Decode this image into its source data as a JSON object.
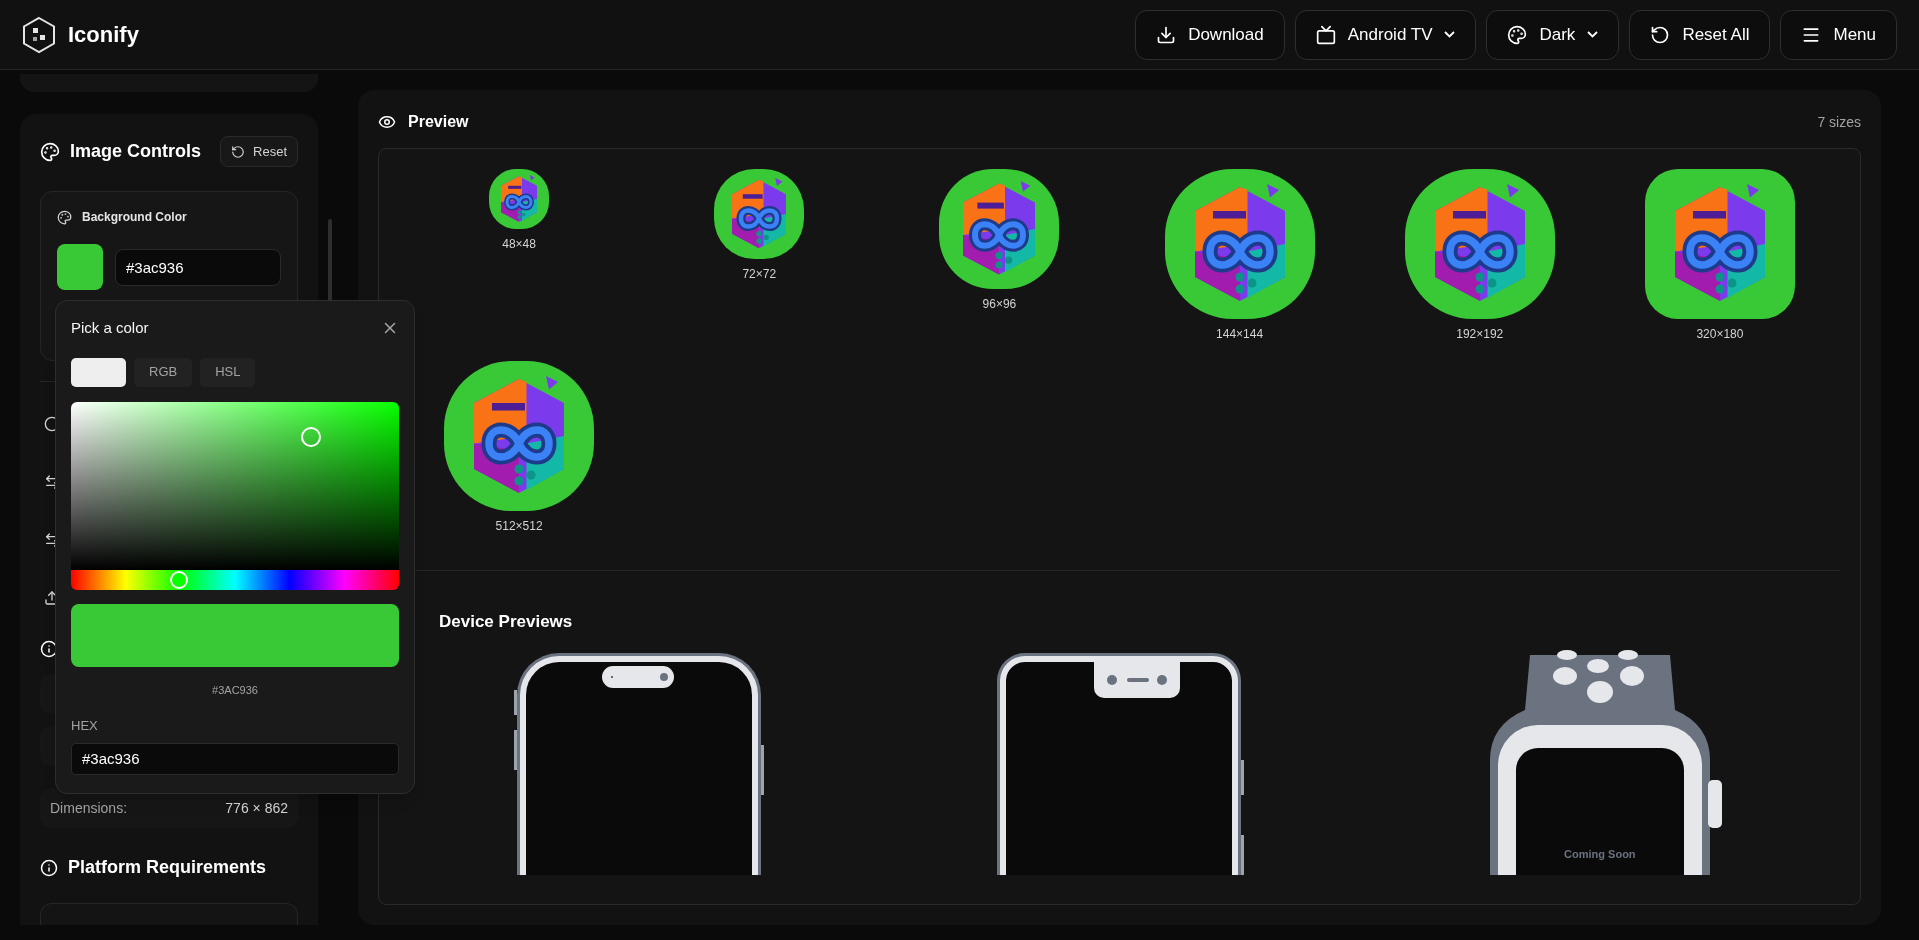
{
  "header": {
    "title": "Iconify",
    "buttons": [
      {
        "label": "Download",
        "dropdown": false
      },
      {
        "label": "Android TV",
        "dropdown": true
      },
      {
        "label": "Dark",
        "dropdown": true
      },
      {
        "label": "Reset All",
        "dropdown": false
      },
      {
        "label": "Menu",
        "dropdown": false
      }
    ]
  },
  "sidebar": {
    "image_controls": {
      "title": "Image Controls",
      "reset": "Reset",
      "background_color": {
        "label": "Background Color",
        "value": "#3ac936",
        "color": "#3ac936"
      }
    },
    "dimensions": {
      "label": "Dimensions:",
      "value": "776 × 862"
    },
    "platform_requirements": {
      "title": "Platform Requirements"
    }
  },
  "color_picker": {
    "title": "Pick a color",
    "color": "#3ac936",
    "tabs": [
      {
        "selected": true
      },
      {
        "label": "RGB",
        "selected": false
      },
      {
        "label": "HSL",
        "selected": false
      }
    ],
    "swatch_label": "#3AC936",
    "hex_label": "HEX",
    "hex_value": "#3ac936"
  },
  "preview": {
    "title": "Preview",
    "count": "7 sizes",
    "icons": [
      {
        "label": "48×48",
        "kind": "round"
      },
      {
        "label": "72×72",
        "kind": "round"
      },
      {
        "label": "96×96",
        "kind": "round"
      },
      {
        "label": "144×144",
        "kind": "round"
      },
      {
        "label": "192×192",
        "kind": "round"
      },
      {
        "label": "320×180",
        "kind": "square"
      },
      {
        "label": "512×512",
        "kind": "round"
      }
    ]
  },
  "device_previews": {
    "title": "Device Previews",
    "devices": [
      {
        "kind": "phone-island"
      },
      {
        "kind": "phone-notch"
      },
      {
        "kind": "watch",
        "label": "Coming Soon"
      }
    ]
  }
}
